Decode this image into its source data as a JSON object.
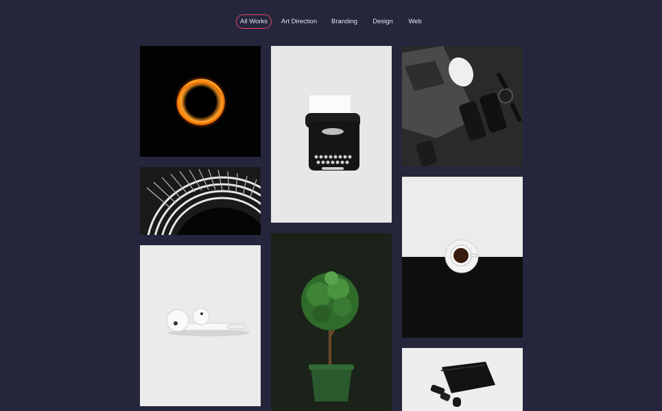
{
  "filters": {
    "active": "All Works",
    "items": [
      {
        "label": "All Works"
      },
      {
        "label": "Art Direction"
      },
      {
        "label": "Branding"
      },
      {
        "label": "Design"
      },
      {
        "label": "Web"
      }
    ]
  },
  "gallery": {
    "items": [
      {
        "subject": "orange light ring on black"
      },
      {
        "subject": "typewriter on white"
      },
      {
        "subject": "laptop, phones, mouse and watch on dark desk"
      },
      {
        "subject": "abstract white spiral architecture"
      },
      {
        "subject": "espresso cup on black and white split"
      },
      {
        "subject": "wireless earbuds on white"
      },
      {
        "subject": "potted topiary tree on dark green"
      },
      {
        "subject": "black laptop and accessories on white"
      }
    ]
  },
  "colors": {
    "background": "#25253c",
    "accent": "#e8475f",
    "text": "#e6e6ee"
  }
}
